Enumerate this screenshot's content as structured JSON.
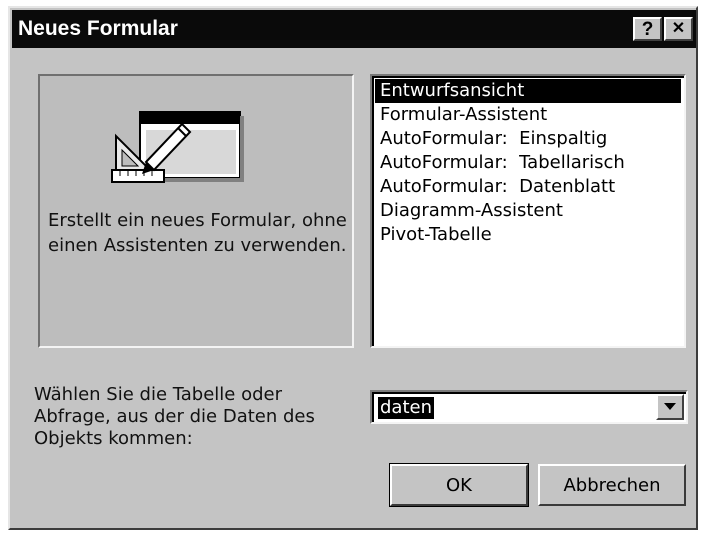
{
  "window": {
    "title": "Neues Formular",
    "help_glyph": "?",
    "close_glyph": "✕"
  },
  "preview": {
    "icon": "form-design-icon",
    "description": "Erstellt ein neues Formular, ohne einen Assistenten zu verwenden."
  },
  "list": {
    "selected_index": 0,
    "items": [
      "Entwurfsansicht",
      "Formular-Assistent",
      "AutoFormular:  Einspaltig",
      "AutoFormular:  Tabellarisch",
      "AutoFormular:  Datenblatt",
      "Diagramm-Assistent",
      "Pivot-Tabelle"
    ]
  },
  "source": {
    "prompt": "Wählen Sie die Tabelle oder Abfrage, aus der die Daten des Objekts kommen:",
    "value": "daten",
    "dropdown_icon": "chevron-down-icon"
  },
  "buttons": {
    "ok": "OK",
    "cancel": "Abbrechen"
  }
}
